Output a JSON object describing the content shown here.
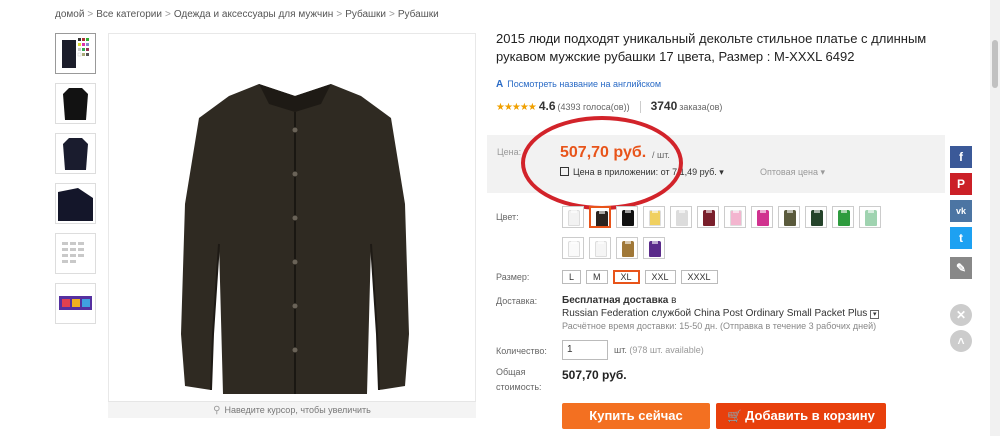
{
  "breadcrumb": [
    "домой",
    "Все категории",
    "Одежда и аксессуары для мужчин",
    "Рубашки",
    "Рубашки"
  ],
  "breadcrumb_sep": ">",
  "zoom_hint": "Наведите курсор, чтобы увеличить",
  "product": {
    "title": "2015 люди подходят уникальный декольте стильное платье с длинным рукавом мужские рубашки 17 цвета, Размер : M-XXXL 6492",
    "translate_link": "Посмотреть название на английском",
    "rating": "4.6",
    "votes": "(4393 голоса(ов))",
    "orders": "3740",
    "orders_label": "заказа(ов)"
  },
  "price": {
    "label": "Цена:",
    "value": "507,70 руб.",
    "unit": "/ шт.",
    "app_price": "Цена в приложении: от 7 1,49 руб.",
    "wholesale": "Оптовая цена"
  },
  "color": {
    "label": "Цвет:",
    "swatches": [
      {
        "name": "white",
        "hex": "#f2f2f2"
      },
      {
        "name": "black-selected",
        "hex": "#2b2420"
      },
      {
        "name": "black",
        "hex": "#111111"
      },
      {
        "name": "yellow",
        "hex": "#f0d060"
      },
      {
        "name": "light-grey",
        "hex": "#dcdcdc"
      },
      {
        "name": "burgundy",
        "hex": "#7a1f2b"
      },
      {
        "name": "pink",
        "hex": "#f3b5cf"
      },
      {
        "name": "magenta",
        "hex": "#d0328f"
      },
      {
        "name": "olive",
        "hex": "#5a5a3c"
      },
      {
        "name": "dark-green",
        "hex": "#24432a"
      },
      {
        "name": "green",
        "hex": "#2e9b3e"
      },
      {
        "name": "mint",
        "hex": "#9fd3b0"
      },
      {
        "name": "white-2",
        "hex": "#fafafa"
      },
      {
        "name": "white-3",
        "hex": "#f5f5f5"
      },
      {
        "name": "khaki",
        "hex": "#a07838"
      },
      {
        "name": "purple",
        "hex": "#5a2a8a"
      }
    ]
  },
  "size": {
    "label": "Размер:",
    "options": [
      "L",
      "M",
      "XL",
      "XXL",
      "XXXL"
    ],
    "selected": "XL"
  },
  "delivery": {
    "label": "Доставка:",
    "free": "Бесплатная доставка",
    "to": "в",
    "via": "Russian Federation службой China Post Ordinary Small Packet Plus",
    "eta": "Расчётное время доставки: 15-50 дн. (Отправка в течение 3 рабочих дней)"
  },
  "quantity": {
    "label": "Количество:",
    "value": "1",
    "unit": "шт.",
    "available": "(978 шт. available)"
  },
  "total": {
    "label_line1": "Общая",
    "label_line2": "стоимость:",
    "value": "507,70 руб."
  },
  "buttons": {
    "buy": "Купить сейчас",
    "cart": "Добавить в корзину"
  },
  "social": {
    "facebook": "f",
    "pinterest": "P",
    "vk": "vk",
    "twitter": "t",
    "edit": "✎"
  },
  "colors": {
    "accent_price": "#e8541a",
    "buy_button": "#f37021",
    "cart_button": "#e8400c",
    "annotation_circle": "#d2232a",
    "shirt": "#2f2a22"
  }
}
